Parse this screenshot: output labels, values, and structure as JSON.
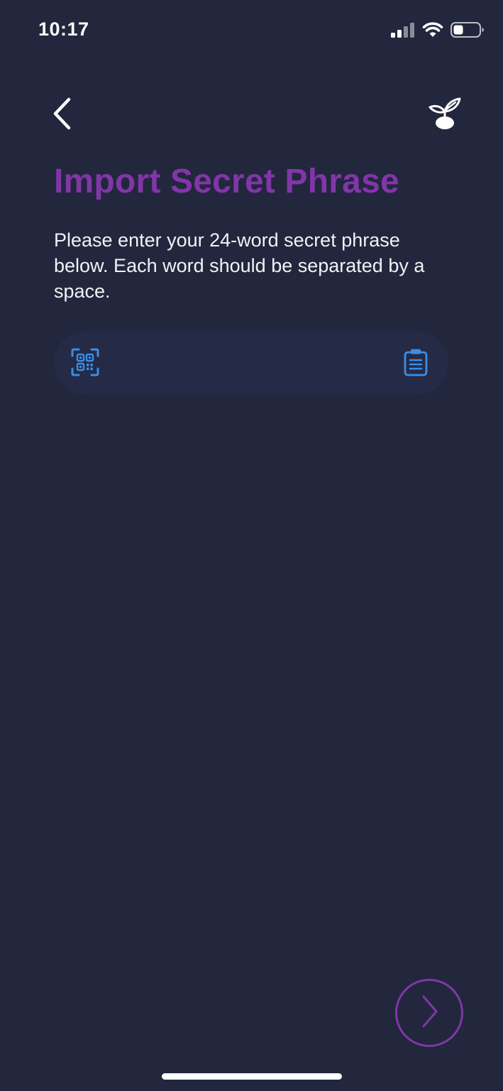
{
  "status_bar": {
    "time": "10:17",
    "icons": [
      "cellular-signal-icon",
      "wifi-icon",
      "battery-icon"
    ]
  },
  "nav": {
    "back_icon": "chevron-left-icon",
    "plant_icon": "sprout-icon"
  },
  "page": {
    "title": "Import Secret Phrase",
    "description": "Please enter your 24-word secret phrase below. Each word should be separated by a space."
  },
  "phrase_field": {
    "value": "",
    "placeholder": "",
    "scan_icon": "qr-scan-icon",
    "paste_icon": "clipboard-icon"
  },
  "next_button": {
    "icon": "chevron-right-icon"
  },
  "colors": {
    "background": "#22273d",
    "field_background": "#252a46",
    "accent_purple": "#8136a7",
    "icon_blue": "#3a8ee6",
    "text": "#ffffff"
  }
}
